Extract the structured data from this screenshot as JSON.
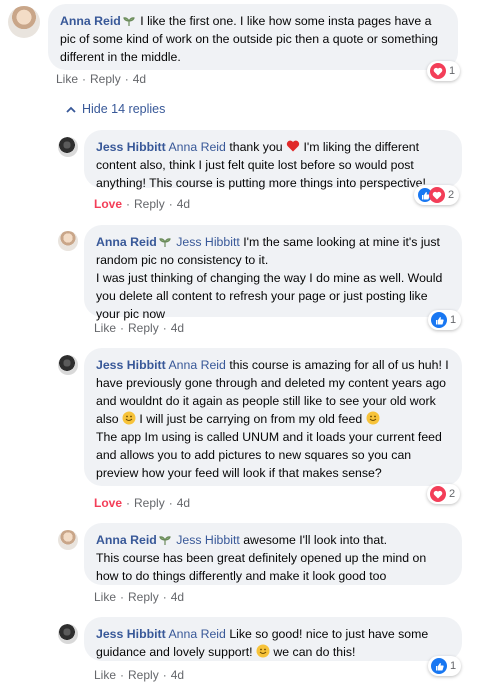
{
  "comments": [
    {
      "author": "Anna Reid",
      "text": "I like the first one. I like how some insta pages have a pic of some kind of work on the outside pic then a quote or something different in the middle.",
      "actions": {
        "like": "Like",
        "reply": "Reply",
        "time": "4d"
      },
      "reaction_count": "1"
    },
    {
      "author": "Jess Hibbitt",
      "mention": "Anna Reid",
      "text_before": "thank you",
      "text_after": "I'm liking the different content also, think I just felt quite lost before so would post anything! This course is putting more things into perspective!",
      "actions": {
        "like": "Love",
        "reply": "Reply",
        "time": "4d"
      },
      "reaction_count": "2"
    },
    {
      "author": "Anna Reid",
      "mention": "Jess Hibbitt",
      "text": "I'm the same looking at mine it's just random pic no consistency to it.\nI was just thinking of changing the way I do mine as well. Would you delete all content to refresh your page or just posting like your pic now",
      "actions": {
        "like": "Like",
        "reply": "Reply",
        "time": "4d"
      },
      "reaction_count": "1"
    },
    {
      "author": "Jess Hibbitt",
      "mention": "Anna Reid",
      "text_part1": "this course is amazing for all of us huh! I have previously gone through and deleted my content years ago and wouldnt do it again as people still like to see your old work also",
      "text_part2": "I will just be carrying on from my old feed",
      "text_part3": "The app Im using is called UNUM and it loads your current feed and allows you to add pictures to new squares so you can preview how your feed will look if that makes sense?",
      "actions": {
        "like": "Love",
        "reply": "Reply",
        "time": "4d"
      },
      "reaction_count": "2"
    },
    {
      "author": "Anna Reid",
      "mention": "Jess Hibbitt",
      "text": "awesome I'll look into that.\nThis course has been great definitely opened up the mind on how to do things differently and make it look good too",
      "actions": {
        "like": "Like",
        "reply": "Reply",
        "time": "4d"
      }
    },
    {
      "author": "Jess Hibbitt",
      "mention": "Anna Reid",
      "text_before": "Like so good! nice to just have some guidance and lovely support!",
      "text_after": "we can do this!",
      "actions": {
        "like": "Like",
        "reply": "Reply",
        "time": "4d"
      },
      "reaction_count": "1"
    }
  ],
  "hide_replies_label": "Hide 14 replies",
  "dot": "·",
  "colors": {
    "link": "#385898",
    "love": "#f33e58",
    "like_blue": "#1877f2",
    "bubble": "#f0f2f5",
    "meta": "#65676b"
  }
}
